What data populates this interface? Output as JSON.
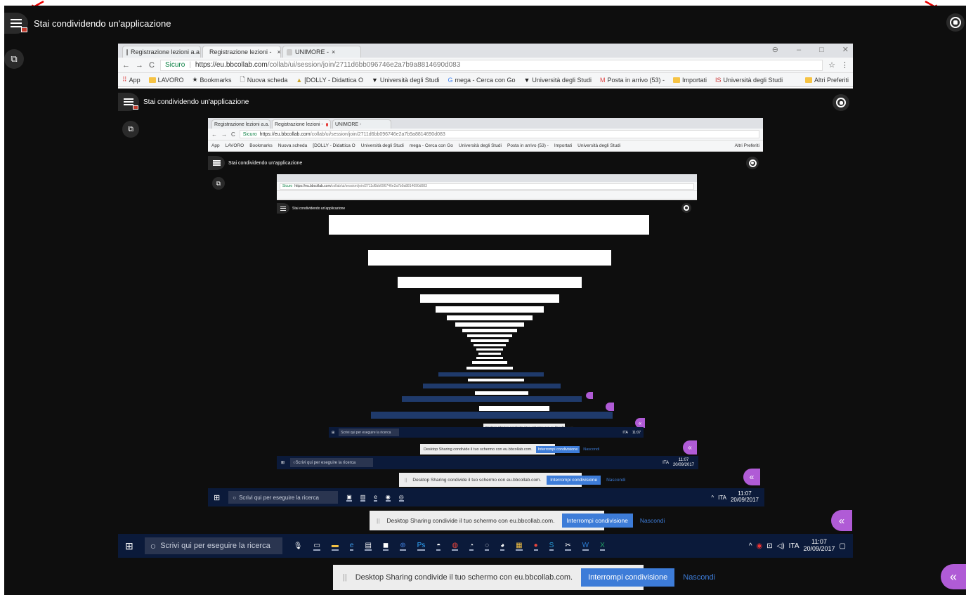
{
  "share": {
    "title": "Stai condividendo un'applicazione"
  },
  "tabs": [
    {
      "label": "Registrazione lezioni a.a."
    },
    {
      "label": "Registrazione lezioni -"
    },
    {
      "label": "UNIMORE -"
    }
  ],
  "address": {
    "secure_label": "Sicuro",
    "url_host": "https://eu.bbcollab.com",
    "url_path": "/collab/ui/session/join/2711d6bb096746e2a7b9a8814690d083"
  },
  "bookmarks": {
    "items": [
      {
        "label": "App"
      },
      {
        "label": "LAVORO"
      },
      {
        "label": "Bookmarks"
      },
      {
        "label": "Nuova scheda"
      },
      {
        "label": "[DOLLY - Didattica O"
      },
      {
        "label": "Università degli Studi"
      },
      {
        "label": "mega - Cerca con Go"
      },
      {
        "label": "Università degli Studi"
      },
      {
        "label": "Posta in arrivo (53) -"
      },
      {
        "label": "Importati"
      },
      {
        "label": "Università degli Studi"
      }
    ],
    "other": "Altri Preferiti"
  },
  "taskbar": {
    "search_placeholder": "Scrivi qui per eseguire la ricerca",
    "lang": "ITA",
    "time": "11:07",
    "date": "20/09/2017"
  },
  "notice": {
    "message": "Desktop Sharing condivide il tuo schermo con eu.bbcollab.com.",
    "stop_label": "Interrompi condivisione",
    "hide_label": "Nascondi"
  },
  "colors": {
    "background": "#0e0e0e",
    "accent_purple": "#b05bd6",
    "stop_blue": "#3d7cd8",
    "taskbar": "#0b1a3a"
  }
}
